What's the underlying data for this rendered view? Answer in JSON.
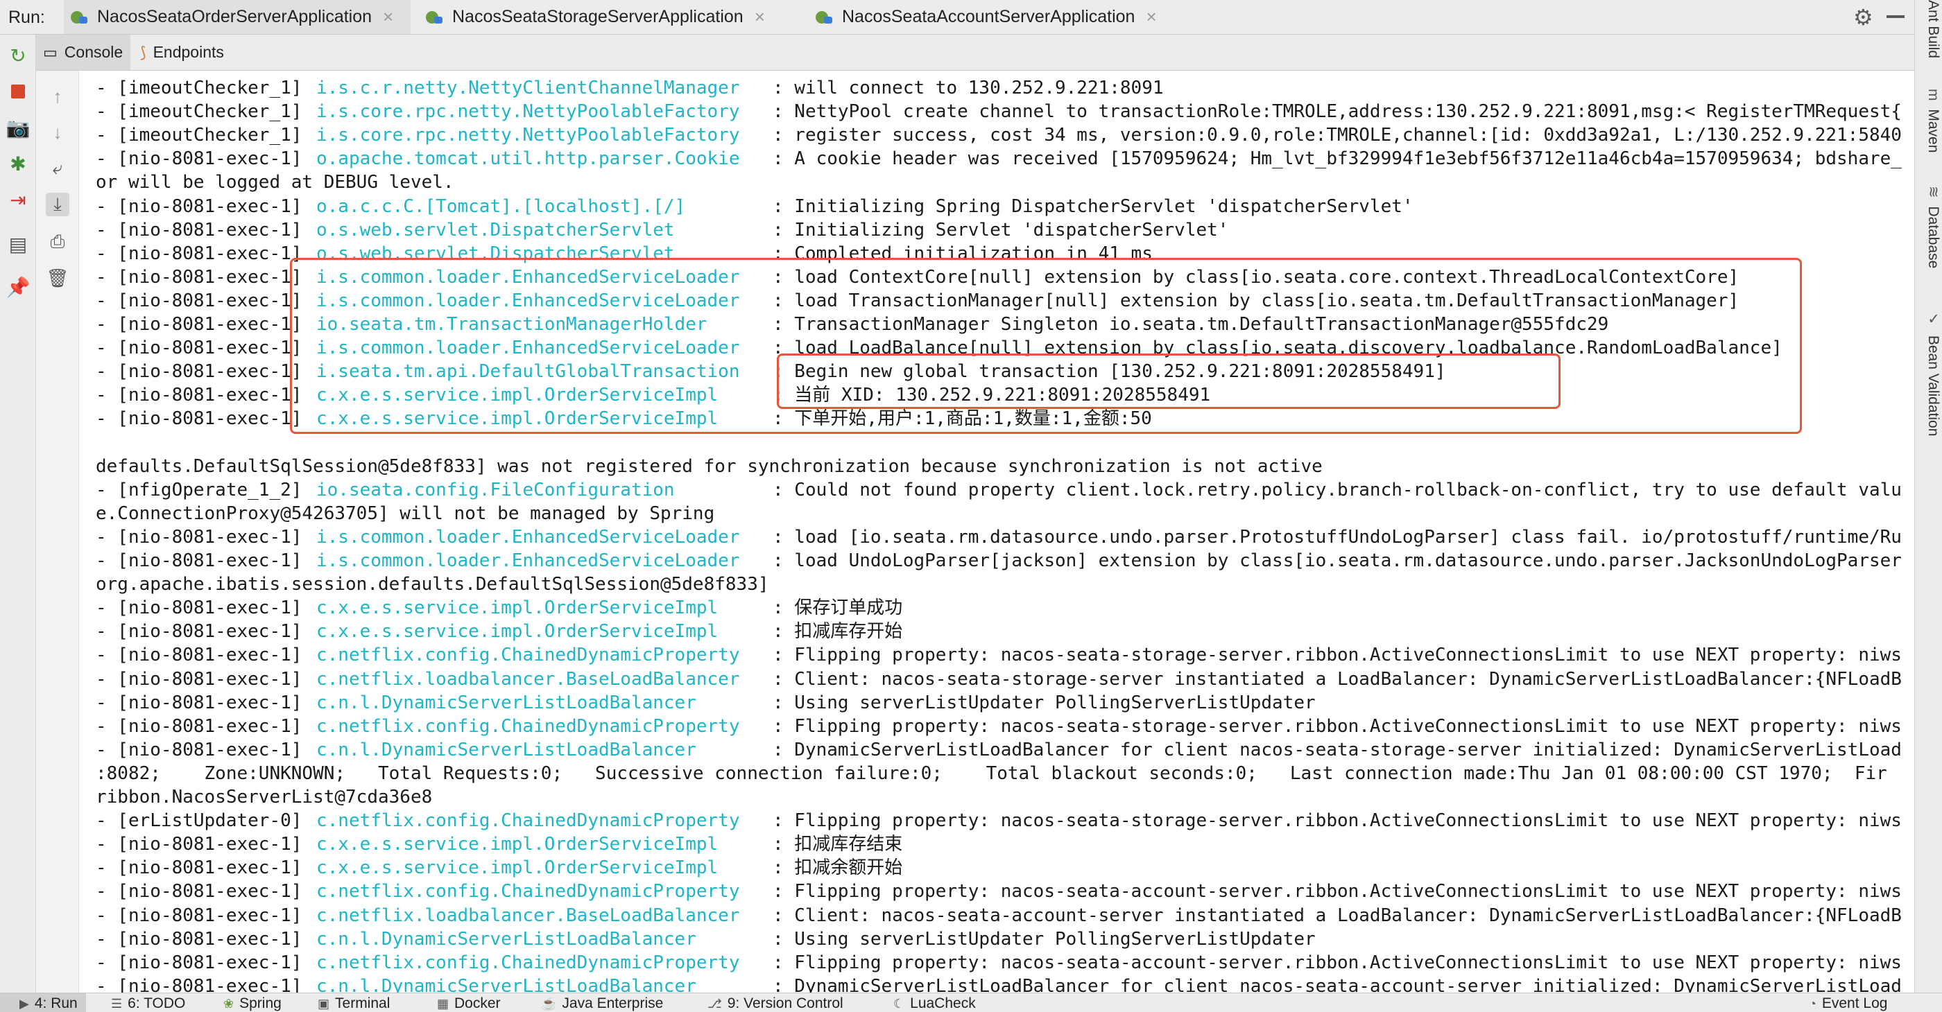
{
  "run_bar": {
    "label": "Run:",
    "tabs": [
      {
        "label": "NacosSeataOrderServerApplication",
        "close": "×",
        "active": true
      },
      {
        "label": "NacosSeataStorageServerApplication",
        "close": "×",
        "active": false
      },
      {
        "label": "NacosSeataAccountServerApplication",
        "close": "×",
        "active": false
      }
    ],
    "settings_icon": "gear-icon",
    "hide_icon": "minimize-icon"
  },
  "console_tabs": [
    {
      "label": "Console",
      "icon": "console-icon",
      "active": true
    },
    {
      "label": "Endpoints",
      "icon": "endpoints-icon",
      "active": false
    }
  ],
  "left_toolbar": [
    "rerun-icon",
    "stop-icon",
    "camera-icon",
    "debug-bug-icon",
    "exit-icon",
    "layout-icon",
    "pin-icon"
  ],
  "console_toolbar": [
    "up-arrow-icon",
    "down-arrow-icon",
    "soft-wrap-icon",
    "scroll-to-end-icon",
    "print-icon",
    "trash-icon"
  ],
  "log_lines": [
    {
      "thread": "- [imeoutChecker_1]",
      "logger": "i.s.c.r.netty.NettyClientChannelManager",
      "msg": ": will connect to 130.252.9.221:8091"
    },
    {
      "thread": "- [imeoutChecker_1]",
      "logger": "i.s.core.rpc.netty.NettyPoolableFactory",
      "msg": ": NettyPool create channel to transactionRole:TMROLE,address:130.252.9.221:8091,msg:< RegisterTMRequest{"
    },
    {
      "thread": "- [imeoutChecker_1]",
      "logger": "i.s.core.rpc.netty.NettyPoolableFactory",
      "msg": ": register success, cost 34 ms, version:0.9.0,role:TMROLE,channel:[id: 0xdd3a92a1, L:/130.252.9.221:5840"
    },
    {
      "thread": "- [nio-8081-exec-1]",
      "logger": "o.apache.tomcat.util.http.parser.Cookie",
      "msg": ": A cookie header was received [1570959624; Hm_lvt_bf329994f1e3ebf56f3712e11a46cb4a=1570959634; bdshare_"
    },
    {
      "cont": "or will be logged at DEBUG level."
    },
    {
      "thread": "- [nio-8081-exec-1]",
      "logger": "o.a.c.c.C.[Tomcat].[localhost].[/]",
      "msg": ": Initializing Spring DispatcherServlet 'dispatcherServlet'"
    },
    {
      "thread": "- [nio-8081-exec-1]",
      "logger": "o.s.web.servlet.DispatcherServlet",
      "msg": ": Initializing Servlet 'dispatcherServlet'"
    },
    {
      "thread": "- [nio-8081-exec-1]",
      "logger": "o.s.web.servlet.DispatcherServlet",
      "msg": ": Completed initialization in 41 ms"
    },
    {
      "thread": "- [nio-8081-exec-1]",
      "logger": "i.s.common.loader.EnhancedServiceLoader",
      "msg": ": load ContextCore[null] extension by class[io.seata.core.context.ThreadLocalContextCore]"
    },
    {
      "thread": "- [nio-8081-exec-1]",
      "logger": "i.s.common.loader.EnhancedServiceLoader",
      "msg": ": load TransactionManager[null] extension by class[io.seata.tm.DefaultTransactionManager]"
    },
    {
      "thread": "- [nio-8081-exec-1]",
      "logger": "io.seata.tm.TransactionManagerHolder",
      "msg": ": TransactionManager Singleton io.seata.tm.DefaultTransactionManager@555fdc29"
    },
    {
      "thread": "- [nio-8081-exec-1]",
      "logger": "i.s.common.loader.EnhancedServiceLoader",
      "msg": ": load LoadBalance[null] extension by class[io.seata.discovery.loadbalance.RandomLoadBalance]"
    },
    {
      "thread": "- [nio-8081-exec-1]",
      "logger": "i.seata.tm.api.DefaultGlobalTransaction",
      "msg": ": Begin new global transaction [130.252.9.221:8091:2028558491]"
    },
    {
      "thread": "- [nio-8081-exec-1]",
      "logger": "c.x.e.s.service.impl.OrderServiceImpl",
      "msg": ": 当前 XID: 130.252.9.221:8091:2028558491"
    },
    {
      "thread": "- [nio-8081-exec-1]",
      "logger": "c.x.e.s.service.impl.OrderServiceImpl",
      "msg": ": 下单开始,用户:1,商品:1,数量:1,金额:50"
    },
    {
      "cont": ""
    },
    {
      "cont": "defaults.DefaultSqlSession@5de8f833] was not registered for synchronization because synchronization is not active"
    },
    {
      "thread": "- [nfigOperate_1_2]",
      "logger": "io.seata.config.FileConfiguration",
      "msg": ": Could not found property client.lock.retry.policy.branch-rollback-on-conflict, try to use default valu"
    },
    {
      "cont": "e.ConnectionProxy@54263705] will not be managed by Spring"
    },
    {
      "thread": "- [nio-8081-exec-1]",
      "logger": "i.s.common.loader.EnhancedServiceLoader",
      "msg": ": load [io.seata.rm.datasource.undo.parser.ProtostuffUndoLogParser] class fail. io/protostuff/runtime/Ru"
    },
    {
      "thread": "- [nio-8081-exec-1]",
      "logger": "i.s.common.loader.EnhancedServiceLoader",
      "msg": ": load UndoLogParser[jackson] extension by class[io.seata.rm.datasource.undo.parser.JacksonUndoLogParser"
    },
    {
      "cont": "org.apache.ibatis.session.defaults.DefaultSqlSession@5de8f833]"
    },
    {
      "thread": "- [nio-8081-exec-1]",
      "logger": "c.x.e.s.service.impl.OrderServiceImpl",
      "msg": ": 保存订单成功"
    },
    {
      "thread": "- [nio-8081-exec-1]",
      "logger": "c.x.e.s.service.impl.OrderServiceImpl",
      "msg": ": 扣减库存开始"
    },
    {
      "thread": "- [nio-8081-exec-1]",
      "logger": "c.netflix.config.ChainedDynamicProperty",
      "msg": ": Flipping property: nacos-seata-storage-server.ribbon.ActiveConnectionsLimit to use NEXT property: niws"
    },
    {
      "thread": "- [nio-8081-exec-1]",
      "logger": "c.netflix.loadbalancer.BaseLoadBalancer",
      "msg": ": Client: nacos-seata-storage-server instantiated a LoadBalancer: DynamicServerListLoadBalancer:{NFLoadB"
    },
    {
      "thread": "- [nio-8081-exec-1]",
      "logger": "c.n.l.DynamicServerListLoadBalancer",
      "msg": ": Using serverListUpdater PollingServerListUpdater"
    },
    {
      "thread": "- [nio-8081-exec-1]",
      "logger": "c.netflix.config.ChainedDynamicProperty",
      "msg": ": Flipping property: nacos-seata-storage-server.ribbon.ActiveConnectionsLimit to use NEXT property: niws"
    },
    {
      "thread": "- [nio-8081-exec-1]",
      "logger": "c.n.l.DynamicServerListLoadBalancer",
      "msg": ": DynamicServerListLoadBalancer for client nacos-seata-storage-server initialized: DynamicServerListLoad"
    },
    {
      "cont": ":8082;    Zone:UNKNOWN;   Total Requests:0;   Successive connection failure:0;    Total blackout seconds:0;   Last connection made:Thu Jan 01 08:00:00 CST 1970;  Fir"
    },
    {
      "cont": "ribbon.NacosServerList@7cda36e8"
    },
    {
      "thread": "- [erListUpdater-0]",
      "logger": "c.netflix.config.ChainedDynamicProperty",
      "msg": ": Flipping property: nacos-seata-storage-server.ribbon.ActiveConnectionsLimit to use NEXT property: niws"
    },
    {
      "thread": "- [nio-8081-exec-1]",
      "logger": "c.x.e.s.service.impl.OrderServiceImpl",
      "msg": ": 扣减库存结束"
    },
    {
      "thread": "- [nio-8081-exec-1]",
      "logger": "c.x.e.s.service.impl.OrderServiceImpl",
      "msg": ": 扣减余额开始"
    },
    {
      "thread": "- [nio-8081-exec-1]",
      "logger": "c.netflix.config.ChainedDynamicProperty",
      "msg": ": Flipping property: nacos-seata-account-server.ribbon.ActiveConnectionsLimit to use NEXT property: niws"
    },
    {
      "thread": "- [nio-8081-exec-1]",
      "logger": "c.netflix.loadbalancer.BaseLoadBalancer",
      "msg": ": Client: nacos-seata-account-server instantiated a LoadBalancer: DynamicServerListLoadBalancer:{NFLoadB"
    },
    {
      "thread": "- [nio-8081-exec-1]",
      "logger": "c.n.l.DynamicServerListLoadBalancer",
      "msg": ": Using serverListUpdater PollingServerListUpdater"
    },
    {
      "thread": "- [nio-8081-exec-1]",
      "logger": "c.netflix.config.ChainedDynamicProperty",
      "msg": ": Flipping property: nacos-seata-account-server.ribbon.ActiveConnectionsLimit to use NEXT property: niws"
    },
    {
      "thread": "- [nio-8081-exec-1]",
      "logger": "c.n.l.DynamicServerListLoadBalancer",
      "msg": ": DynamicServerListLoadBalancer for client nacos-seata-account-server initialized: DynamicServerListLoad"
    }
  ],
  "right_sidebar": [
    {
      "label": "Ant Build",
      "icon": "ant-icon"
    },
    {
      "label": "Maven",
      "icon": "maven-icon"
    },
    {
      "label": "Database",
      "icon": "database-icon"
    },
    {
      "label": "Bean Validation",
      "icon": "bean-validation-icon"
    }
  ],
  "bottom_bar": [
    {
      "label": "4: Run",
      "icon": "run-icon",
      "active": true
    },
    {
      "label": "6: TODO",
      "icon": "todo-icon",
      "active": false
    },
    {
      "label": "Spring",
      "icon": "spring-icon",
      "active": false
    },
    {
      "label": "Terminal",
      "icon": "terminal-icon",
      "active": false
    },
    {
      "label": "Docker",
      "icon": "docker-icon",
      "active": false
    },
    {
      "label": "Java Enterprise",
      "icon": "java-enterprise-icon",
      "active": false
    },
    {
      "label": "9: Version Control",
      "icon": "version-control-icon",
      "active": false
    },
    {
      "label": "LuaCheck",
      "icon": "luacheck-icon",
      "active": false
    },
    {
      "label": "Event Log",
      "icon": "event-log-icon",
      "active": false
    }
  ],
  "colors": {
    "logger_text": "#1eb6c6",
    "highlight_box": "#e8553a",
    "toolbar_bg": "#ececec"
  }
}
